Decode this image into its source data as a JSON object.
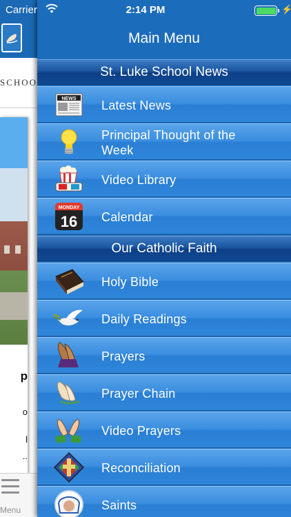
{
  "status_bar": {
    "carrier": "Carrier",
    "time": "2:14 PM"
  },
  "background_app": {
    "header_text": "SCHOOL",
    "card_text_1": "p",
    "card_text_2": "o",
    "card_text_3": "l",
    "card_text_4": "..",
    "tab_label": "Menu"
  },
  "drawer": {
    "title": "Main Menu",
    "sections": [
      {
        "title": "St. Luke School News",
        "items": [
          {
            "label": "Latest News",
            "icon": "newspaper-icon"
          },
          {
            "label": "Principal Thought of the Week",
            "icon": "lightbulb-icon"
          },
          {
            "label": "Video Library",
            "icon": "popcorn-3d-glasses-icon"
          },
          {
            "label": "Calendar",
            "icon": "calendar-icon",
            "calendar_month": "MONDAY",
            "calendar_day": "16"
          }
        ]
      },
      {
        "title": "Our Catholic Faith",
        "items": [
          {
            "label": "Holy Bible",
            "icon": "bible-icon"
          },
          {
            "label": "Daily Readings",
            "icon": "dove-icon"
          },
          {
            "label": "Prayers",
            "icon": "praying-hands-icon"
          },
          {
            "label": "Prayer Chain",
            "icon": "praying-hands-light-icon"
          },
          {
            "label": "Video Prayers",
            "icon": "praying-hands-green-icon"
          },
          {
            "label": "Reconciliation",
            "icon": "stained-glass-cross-icon"
          },
          {
            "label": "Saints",
            "icon": "saint-portrait-icon"
          }
        ]
      }
    ]
  },
  "colors": {
    "drawer_bg": "#1c6cbc",
    "item_gradient_top": "#5aa4ea",
    "section_dark": "#0c3f86",
    "battery_green": "#4cd964"
  }
}
